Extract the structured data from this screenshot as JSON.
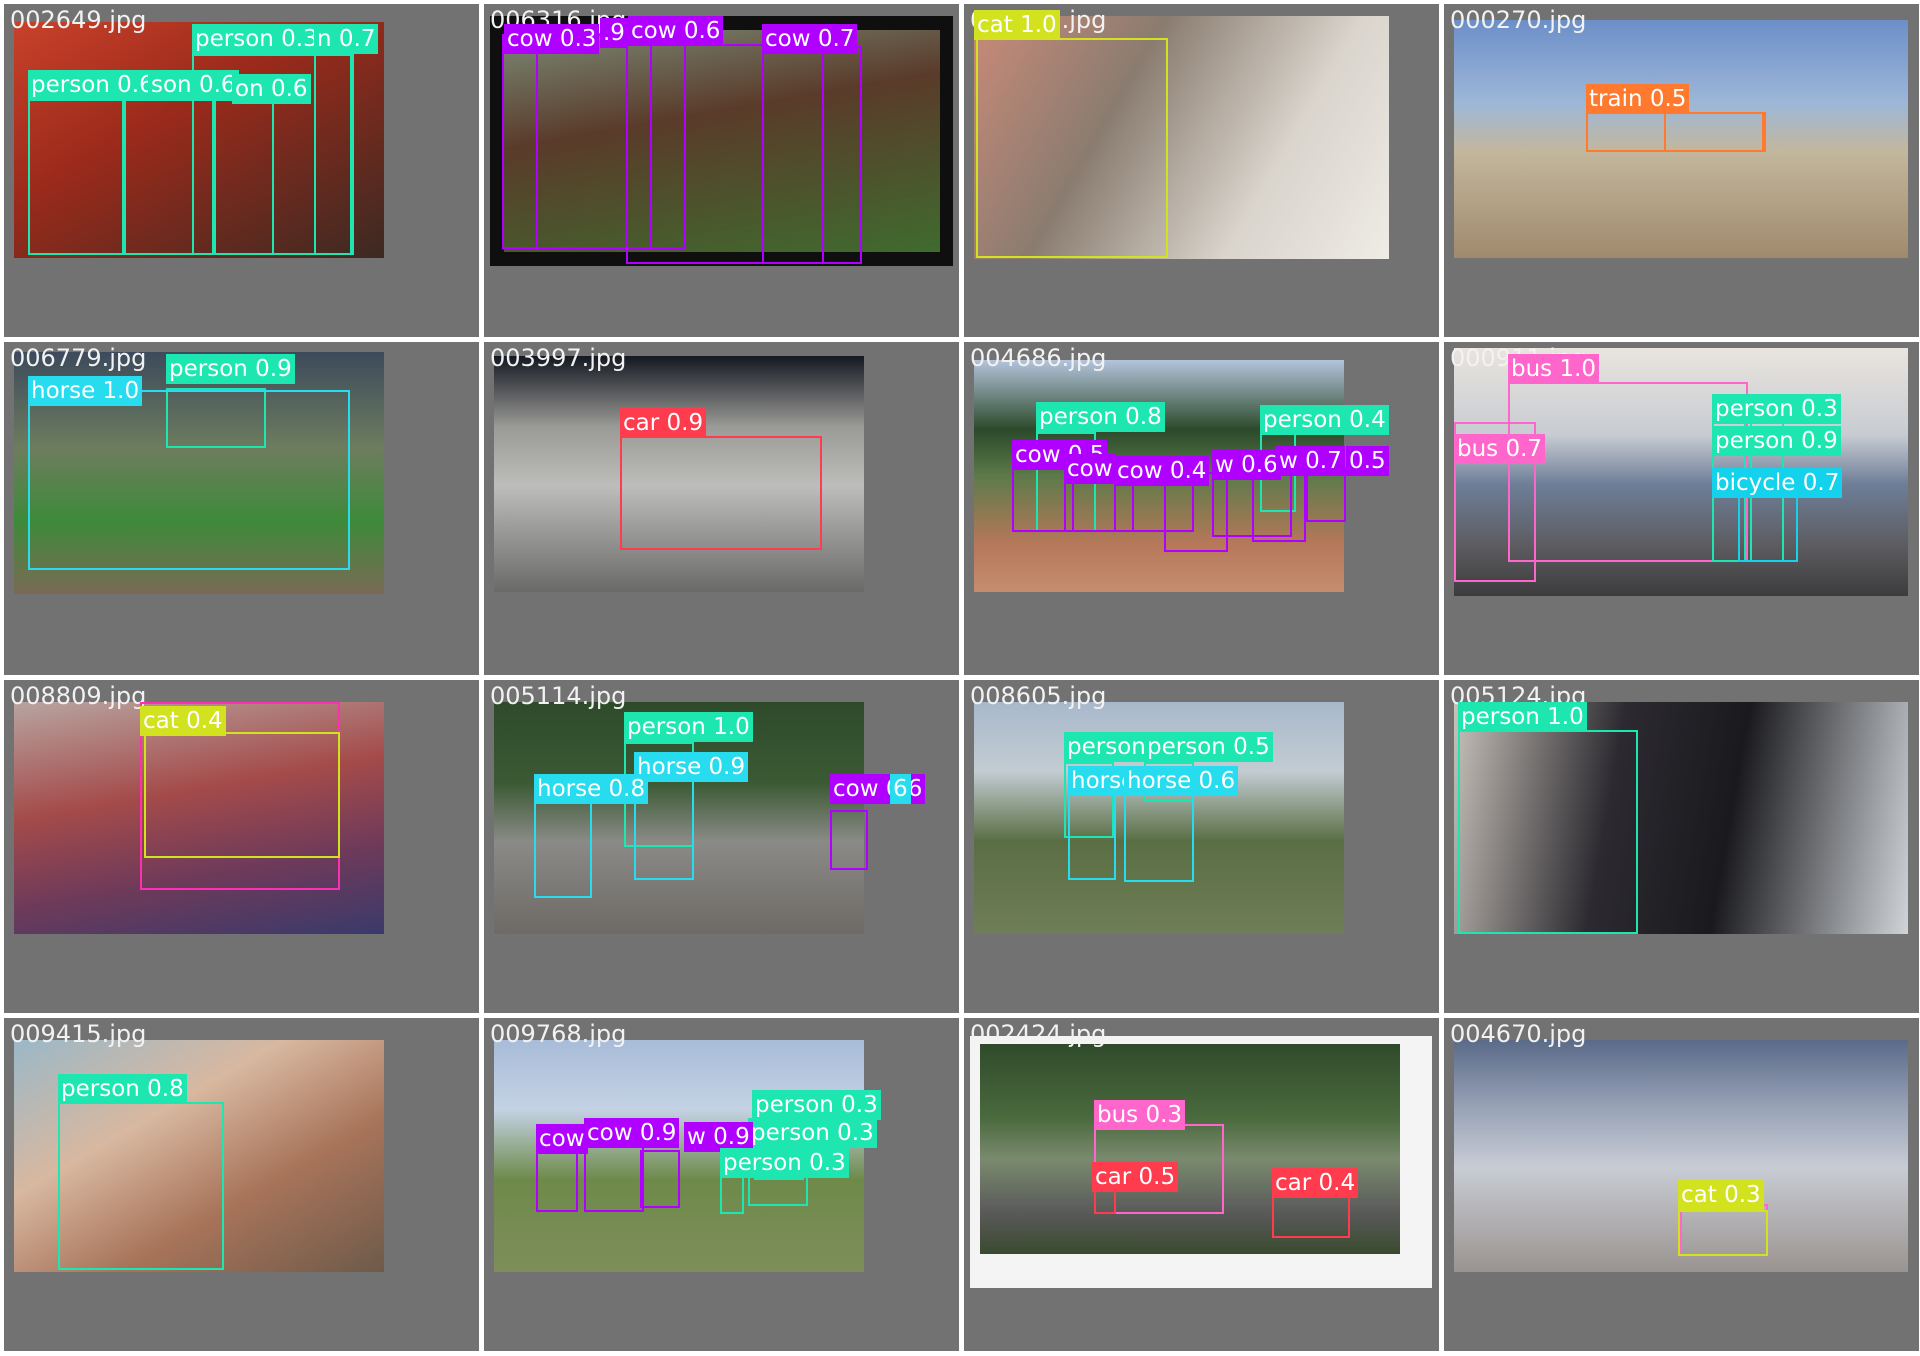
{
  "colors": {
    "person": "#1ee6b0",
    "cow": "#b000ff",
    "cat": "#d2e21e",
    "train": "#ff7a2e",
    "horse": "#27dcee",
    "car": "#ff3b4e",
    "bus": "#ff66cc",
    "bicycle": "#15d2ec",
    "mosaic_border": "#727272",
    "filename_text": "#f2f2f2"
  },
  "tiles": [
    {
      "filename": "002649.jpg",
      "labels": [
        "person 0.3",
        "n 0.7",
        "person 0.6",
        "son 0.6",
        "on 0.6"
      ]
    },
    {
      "filename": "006316.jpg",
      "labels": [
        "cow 0.3",
        ".9",
        "cow 0.6",
        "cow 0.7"
      ]
    },
    {
      "filename": "003777.jpg",
      "labels": [
        "cat 1.0"
      ]
    },
    {
      "filename": "000270.jpg",
      "labels": [
        "train 0.5"
      ]
    },
    {
      "filename": "006779.jpg",
      "labels": [
        "person 0.9",
        "horse 1.0"
      ]
    },
    {
      "filename": "003997.jpg",
      "labels": [
        "car 0.9"
      ]
    },
    {
      "filename": "004686.jpg",
      "labels": [
        "person 0.8",
        "person 0.4",
        "cow 0.5",
        "cow",
        "cow 0.4",
        "w 0.6",
        "w 0.7",
        "0.5"
      ]
    },
    {
      "filename": "000911.jpg",
      "labels": [
        "bus 1.0",
        "person 0.3",
        "person 0.9",
        "bus 0.7",
        "bicycle 0.7"
      ]
    },
    {
      "filename": "008809.jpg",
      "labels": [
        "cat 0.4"
      ]
    },
    {
      "filename": "005114.jpg",
      "labels": [
        "person 1.0",
        "horse 0.9",
        "horse 0.8",
        "cow 0.6",
        "6"
      ]
    },
    {
      "filename": "008605.jpg",
      "labels": [
        "person",
        "person 0.5",
        "horse",
        "horse 0.6"
      ]
    },
    {
      "filename": "005124.jpg",
      "labels": [
        "person 1.0"
      ]
    },
    {
      "filename": "009415.jpg",
      "labels": [
        "person 0.8"
      ]
    },
    {
      "filename": "009768.jpg",
      "labels": [
        "person 0.3",
        "person 0.3",
        "cow",
        "cow 0.9",
        "w 0.9",
        "person 0.3"
      ]
    },
    {
      "filename": "002424.jpg",
      "labels": [
        "bus 0.3",
        "car 0.5",
        "car 0.4"
      ]
    },
    {
      "filename": "004670.jpg",
      "labels": [
        "cat 0.3"
      ]
    }
  ]
}
